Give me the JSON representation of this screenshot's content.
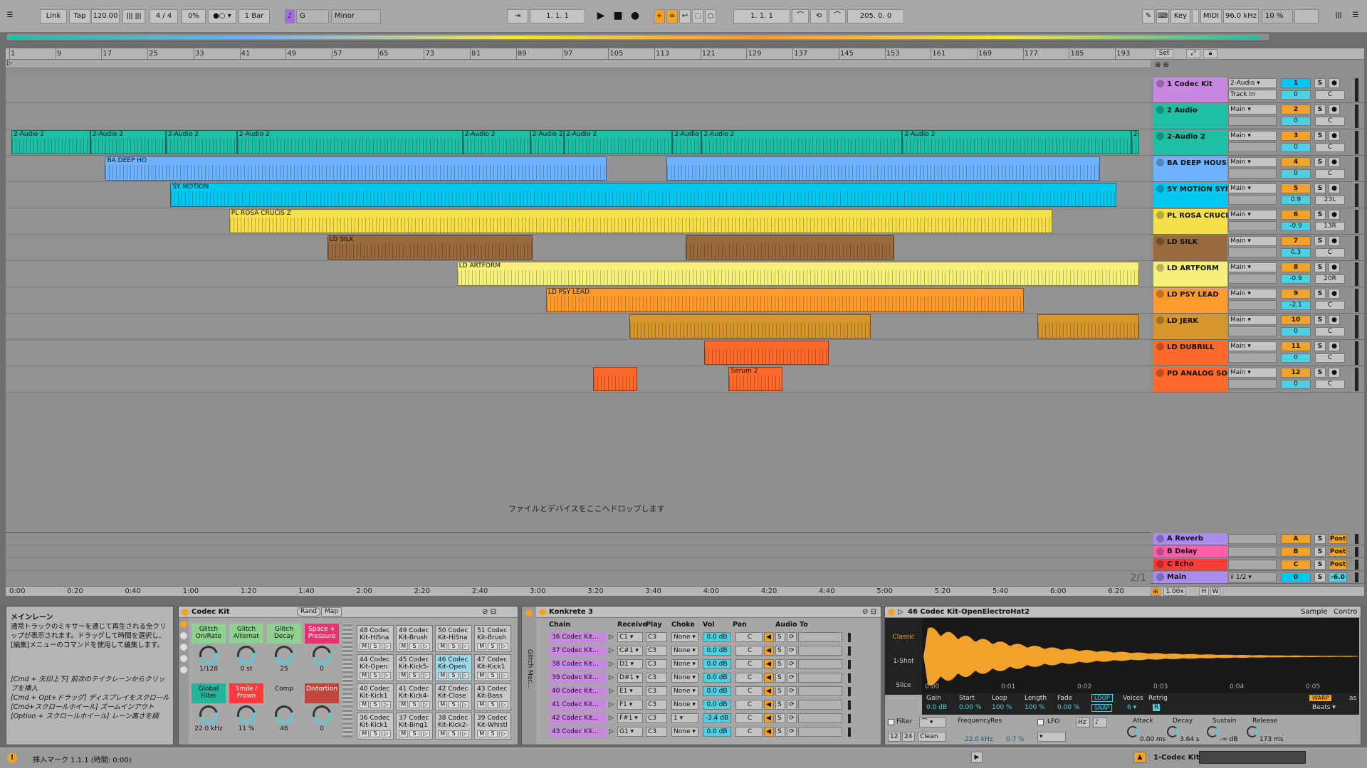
{
  "transport": {
    "link": "Link",
    "tap": "Tap",
    "tempo": "120.00",
    "signature": "4 / 4",
    "groove": "0%",
    "quantize": "1 Bar",
    "key": "G",
    "scale": "Minor",
    "position": "1.  1.  1",
    "loop_start": "1.  1.  1",
    "loop_length": "205.  0.  0",
    "key_label": "Key",
    "midi_label": "MIDI",
    "sample_rate": "96.0 kHz",
    "cpu": "10 %",
    "accent": "#f0a22a"
  },
  "ruler": {
    "bars": [
      "1",
      "9",
      "17",
      "25",
      "33",
      "41",
      "49",
      "57",
      "65",
      "73",
      "81",
      "89",
      "97",
      "105",
      "113",
      "121",
      "129",
      "137",
      "145",
      "153",
      "161",
      "169",
      "177",
      "185",
      "193"
    ],
    "set_label": "Set"
  },
  "times": [
    "0:00",
    "0:20",
    "0:40",
    "1:00",
    "1:20",
    "1:40",
    "2:00",
    "2:20",
    "2:40",
    "3:00",
    "3:20",
    "3:40",
    "4:00",
    "4:20",
    "4:40",
    "5:00",
    "5:20",
    "5:40",
    "6:00",
    "6:20"
  ],
  "drop_hint": "ファイルとデバイスをここへドロップします",
  "page_indicator": "2/1",
  "zoom": "1.00x",
  "tracks": [
    {
      "name": "1 Codec Kit",
      "color": "#c988e0",
      "output": "2-Audio",
      "input": "Track In",
      "num": "1",
      "vol": "0",
      "pan": "C",
      "clips": []
    },
    {
      "name": "2 Audio",
      "color": "#1fbfa5",
      "output": "Main",
      "num": "2",
      "vol": "0",
      "pan": "C",
      "clips": []
    },
    {
      "name": "2-Audio 2",
      "color": "#1fbfa5",
      "output": "Main",
      "num": "3",
      "vol": "0",
      "pan": "C",
      "clips": [
        {
          "label": "2-Audio 2",
          "start": 0.0,
          "end": 0.07
        },
        {
          "label": "2-Audio 2",
          "start": 0.07,
          "end": 0.137
        },
        {
          "label": "2-Audio 2",
          "start": 0.137,
          "end": 0.2
        },
        {
          "label": "2-Audio 2",
          "start": 0.2,
          "end": 0.4
        },
        {
          "label": "2-Audio 2",
          "start": 0.4,
          "end": 0.46
        },
        {
          "label": "2-Audio 2",
          "start": 0.46,
          "end": 0.49
        },
        {
          "label": "2-Audio 2",
          "start": 0.49,
          "end": 0.586
        },
        {
          "label": "2-Audio 2",
          "start": 0.586,
          "end": 0.612
        },
        {
          "label": "2-Audio 2",
          "start": 0.612,
          "end": 0.79
        },
        {
          "label": "2-Audio 2",
          "start": 0.79,
          "end": 0.993
        },
        {
          "label": "2-A",
          "start": 0.993,
          "end": 1.0
        }
      ]
    },
    {
      "name": "BA DEEP HOUSE",
      "color": "#6fb2ff",
      "output": "Main",
      "num": "4",
      "vol": "0",
      "pan": "C",
      "clips": [
        {
          "label": "BA DEEP HO",
          "start": 0.083,
          "end": 0.528
        },
        {
          "label": "",
          "start": 0.581,
          "end": 0.965
        }
      ]
    },
    {
      "name": "SY MOTION SYN",
      "color": "#00c8f0",
      "output": "Main",
      "num": "5",
      "vol": "0.9",
      "pan": "23L",
      "clips": [
        {
          "label": "SY MOTION",
          "start": 0.141,
          "end": 0.98
        }
      ]
    },
    {
      "name": "PL ROSA CRUCI",
      "color": "#f5e04a",
      "output": "Main",
      "num": "6",
      "vol": "-0.9",
      "pan": "13R",
      "clips": [
        {
          "label": "PL ROSA CRUCIS Z",
          "start": 0.193,
          "end": 0.923
        }
      ]
    },
    {
      "name": "LD SILK",
      "color": "#9b6a3c",
      "output": "Main",
      "num": "7",
      "vol": "0.3",
      "pan": "C",
      "clips": [
        {
          "label": "LD SILK",
          "start": 0.28,
          "end": 0.462
        },
        {
          "label": "",
          "start": 0.598,
          "end": 0.783
        }
      ]
    },
    {
      "name": "LD ARTFORM",
      "color": "#f6ef79",
      "output": "Main",
      "num": "8",
      "vol": "-0.9",
      "pan": "20R",
      "clips": [
        {
          "label": "LD ARTFORM",
          "start": 0.395,
          "end": 1.0
        }
      ]
    },
    {
      "name": "LD PSY LEAD",
      "color": "#ff9a2e",
      "output": "Main",
      "num": "9",
      "vol": "-2.1",
      "pan": "C",
      "clips": [
        {
          "label": "LD PSY LEAD",
          "start": 0.474,
          "end": 0.898
        }
      ]
    },
    {
      "name": "LD JERK",
      "color": "#d7962c",
      "output": "Main",
      "num": "10",
      "vol": "0",
      "pan": "C",
      "clips": [
        {
          "label": "",
          "start": 0.548,
          "end": 0.762
        },
        {
          "label": "",
          "start": 0.91,
          "end": 1.0
        }
      ]
    },
    {
      "name": "LD DUBRILL",
      "color": "#ff6a2a",
      "output": "Main",
      "num": "11",
      "vol": "0",
      "pan": "C",
      "clips": [
        {
          "label": "",
          "start": 0.614,
          "end": 0.725
        }
      ]
    },
    {
      "name": "PD ANALOG SO",
      "color": "#ff6a2a",
      "output": "Main",
      "num": "12",
      "vol": "0",
      "pan": "C",
      "clips": [
        {
          "label": "",
          "start": 0.516,
          "end": 0.555
        },
        {
          "label": "Serum 2",
          "start": 0.636,
          "end": 0.684
        }
      ]
    }
  ],
  "returns": [
    {
      "name": "A Reverb",
      "color": "#a88cf0",
      "num": "A",
      "post": "Post"
    },
    {
      "name": "B Delay",
      "color": "#ff60a8",
      "num": "B",
      "post": "Post"
    },
    {
      "name": "C Echo",
      "color": "#ff3b3b",
      "num": "C",
      "post": "Post"
    }
  ],
  "main": {
    "name": "Main",
    "color": "#a88cf0",
    "output": "ii 1/2",
    "vol": "0",
    "pan": "-6.0"
  },
  "info": {
    "title": "メインレーン",
    "body": "通常トラックのミキサーを通じて再生される全クリップが表示されます。ドラッグして時間を選択し、[編集]メニューのコマンドを使用して編集します。",
    "hints": [
      "[Cmd + 矢印上下] 前次のテイクレーンからクリップを挿入",
      "[Cmd + Opt+ドラッグ] ディスプレイをスクロール",
      "[Cmd+スクロールホイール] ズームインアウト",
      "[Option + スクロールホイール] レーン高さを調"
    ]
  },
  "codec_kit": {
    "title": "Codec Kit",
    "rand": "Rand",
    "map": "Map",
    "macros": [
      {
        "label": "Glitch On/Rate",
        "value": "1/128",
        "color": "#8fd28f"
      },
      {
        "label": "Glitch Alternat",
        "value": "0 st",
        "color": "#8fd28f"
      },
      {
        "label": "Glitch Decay",
        "value": "25",
        "color": "#8fd28f"
      },
      {
        "label": "Space + Pressure",
        "value": "0",
        "color": "#e8336f"
      },
      {
        "label": "Global Filter",
        "value": "22.0 kHz",
        "color": "#22b59a"
      },
      {
        "label": "Smile / Frown",
        "value": "11 %",
        "color": "#ff3b3b"
      },
      {
        "label": "Comp",
        "value": "46",
        "color": "#a7a7a7"
      },
      {
        "label": "Distortion",
        "value": "0",
        "color": "#c0463b"
      }
    ],
    "pads": [
      "48 Codec Kit-HiSna",
      "49 Codec Kit-Brush",
      "50 Codec Kit-HiSna",
      "51 Codec Kit-Brush",
      "44 Codec Kit-Open",
      "45 Codec Kit-Kick5-",
      "46 Codec Kit-Open",
      "47 Codec Kit-Kick1",
      "40 Codec Kit-Kick1",
      "41 Codec Kit-Kick4-",
      "42 Codec Kit-Close",
      "43 Codec Kit-Bass",
      "36 Codec Kit-Kick1",
      "37 Codec Kit-Bing1",
      "38 Codec Kit-Kick2-",
      "39 Codec Kit-Whistl"
    ],
    "pad_buttons": [
      "M",
      "S",
      "▷"
    ]
  },
  "konkrete": {
    "title": "Konkrete 3",
    "side_label": "Glitch Mac...",
    "headers": {
      "chain": "Chain",
      "receive": "Receive",
      "play": "Play",
      "choke": "Choke",
      "vol": "Vol",
      "pan": "Pan",
      "audio_to": "Audio To"
    },
    "chains": [
      {
        "name": "36 Codec Kit...",
        "receive": "C1",
        "play": "C3",
        "choke": "None",
        "vol": "0.0 dB",
        "pan": "C"
      },
      {
        "name": "37 Codec Kit...",
        "receive": "C#1",
        "play": "C3",
        "choke": "None",
        "vol": "0.0 dB",
        "pan": "C"
      },
      {
        "name": "38 Codec Kit...",
        "receive": "D1",
        "play": "C3",
        "choke": "None",
        "vol": "0.0 dB",
        "pan": "C"
      },
      {
        "name": "39 Codec Kit...",
        "receive": "D#1",
        "play": "C3",
        "choke": "None",
        "vol": "0.0 dB",
        "pan": "C"
      },
      {
        "name": "40 Codec Kit...",
        "receive": "E1",
        "play": "C3",
        "choke": "None",
        "vol": "0.0 dB",
        "pan": "C"
      },
      {
        "name": "41 Codec Kit...",
        "receive": "F1",
        "play": "C3",
        "choke": "None",
        "vol": "0.0 dB",
        "pan": "C"
      },
      {
        "name": "42 Codec Kit...",
        "receive": "F#1",
        "play": "C3",
        "choke": "1",
        "vol": "-3.4 dB",
        "pan": "C"
      },
      {
        "name": "43 Codec Kit...",
        "receive": "G1",
        "play": "C3",
        "choke": "None",
        "vol": "0.0 dB",
        "pan": "C"
      }
    ]
  },
  "sampler": {
    "title": "46 Codec Kit-OpenElectroHat2",
    "tabs": [
      "Sample",
      "Contro"
    ],
    "modes": [
      "Classic",
      "1-Shot",
      "Slice"
    ],
    "time_marks": [
      "0:00",
      "0:01",
      "0:02",
      "0:03",
      "0:04",
      "0:05"
    ],
    "params": [
      {
        "label": "Gain",
        "value": "0.0 dB"
      },
      {
        "label": "Start",
        "value": "0.00 %"
      },
      {
        "label": "Loop",
        "value": "100 %"
      },
      {
        "label": "Length",
        "value": "100 %"
      },
      {
        "label": "Fade",
        "value": "0.00 %"
      }
    ],
    "loop_label": "LOOP",
    "snap_label": "SNAP",
    "voices_label": "Voices",
    "voices_value": "6",
    "retrig_label": "Retrig",
    "retrig_value": "R",
    "warp_label": "WARP",
    "as_label": "as",
    "beats_label": "Beats",
    "filter_label": "Filter",
    "filter_type": "Clean",
    "filter_vals": [
      "12",
      "24"
    ],
    "freq_label": "Frequency",
    "freq_value": "22.0 kHz",
    "res_label": "Res",
    "res_value": "0.7 %",
    "lfo_label": "LFO",
    "hz_label": "Hz",
    "env": [
      {
        "label": "Attack",
        "value": "0.00 ms"
      },
      {
        "label": "Decay",
        "value": "3.64 s"
      },
      {
        "label": "Sustain",
        "value": "-∞ dB"
      },
      {
        "label": "Release",
        "value": "173 ms"
      }
    ],
    "waveform_color": "#f0a22a"
  },
  "status": {
    "message": "挿入マーク 1.1.1 (時間: 0:00)",
    "track": "1-Codec Kit"
  }
}
